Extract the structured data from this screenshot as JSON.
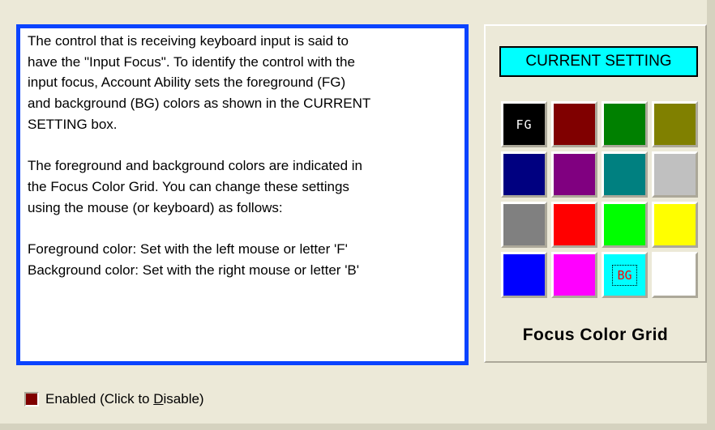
{
  "help": {
    "paragraph1": "The control that is receiving keyboard input is said to\nhave the \"Input Focus\". To identify the control with the\ninput focus, Account Ability sets the foreground (FG)\nand background (BG) colors as shown in the CURRENT\nSETTING box.",
    "paragraph2": "The foreground and background colors are indicated in\nthe Focus Color Grid. You can change these settings\nusing the mouse (or keyboard) as follows:",
    "paragraph3": "Foreground color: Set with the left mouse or letter 'F'\nBackground color: Set with the right mouse or letter 'B'"
  },
  "current_setting": {
    "label": "CURRENT SETTING",
    "fg_color": "#000000",
    "bg_color": "#00ffff"
  },
  "grid": {
    "caption": "Focus Color Grid",
    "fg_marker": "FG",
    "bg_marker": "BG",
    "colors": [
      "#000000",
      "#800000",
      "#008000",
      "#808000",
      "#000080",
      "#800080",
      "#008080",
      "#c0c0c0",
      "#808080",
      "#ff0000",
      "#00ff00",
      "#ffff00",
      "#0000ff",
      "#ff00ff",
      "#00ffff",
      "#ffffff"
    ],
    "fg_index": 0,
    "bg_index": 14
  },
  "toggle": {
    "prefix": "Enabled (Click to ",
    "mnemonic": "D",
    "suffix": "isable)",
    "state_color": "#800000"
  },
  "accent": {
    "focus_border": "#0a43ff"
  }
}
